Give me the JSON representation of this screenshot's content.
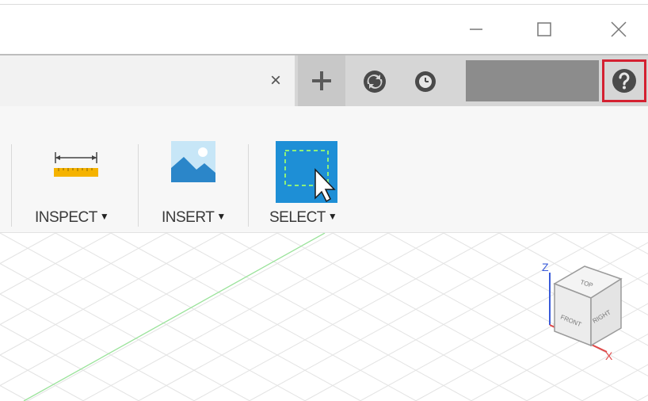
{
  "window": {
    "minimize_label": "—",
    "maximize_label": "☐",
    "close_label": "✕"
  },
  "tabbar": {
    "close_tab_label": "×",
    "new_tab_label": "+",
    "icons": [
      "close-tab-icon",
      "new-tab-icon",
      "job-status-icon",
      "recent-icon",
      "help-icon"
    ],
    "help_highlight_color": "#d42031"
  },
  "toolbar": {
    "inspect_label": "INSPECT",
    "insert_label": "INSERT",
    "select_label": "SELECT",
    "dropdown_glyph": "▼",
    "icons": [
      "measure-ruler-icon",
      "insert-image-icon",
      "select-cursor-icon"
    ],
    "accent_color": "#1e8fd6",
    "ruler_color": "#f5b300"
  },
  "viewcube": {
    "face_front": "FRONT",
    "face_right": "RIGHT",
    "face_top": "TOP",
    "axis_z": "Z",
    "axis_x": "X",
    "axis_z_color": "#3a5bd9",
    "axis_x_color": "#e04848"
  },
  "canvas": {
    "grid_color": "#e3e3e3",
    "axis_line_color": "#9be39b"
  }
}
